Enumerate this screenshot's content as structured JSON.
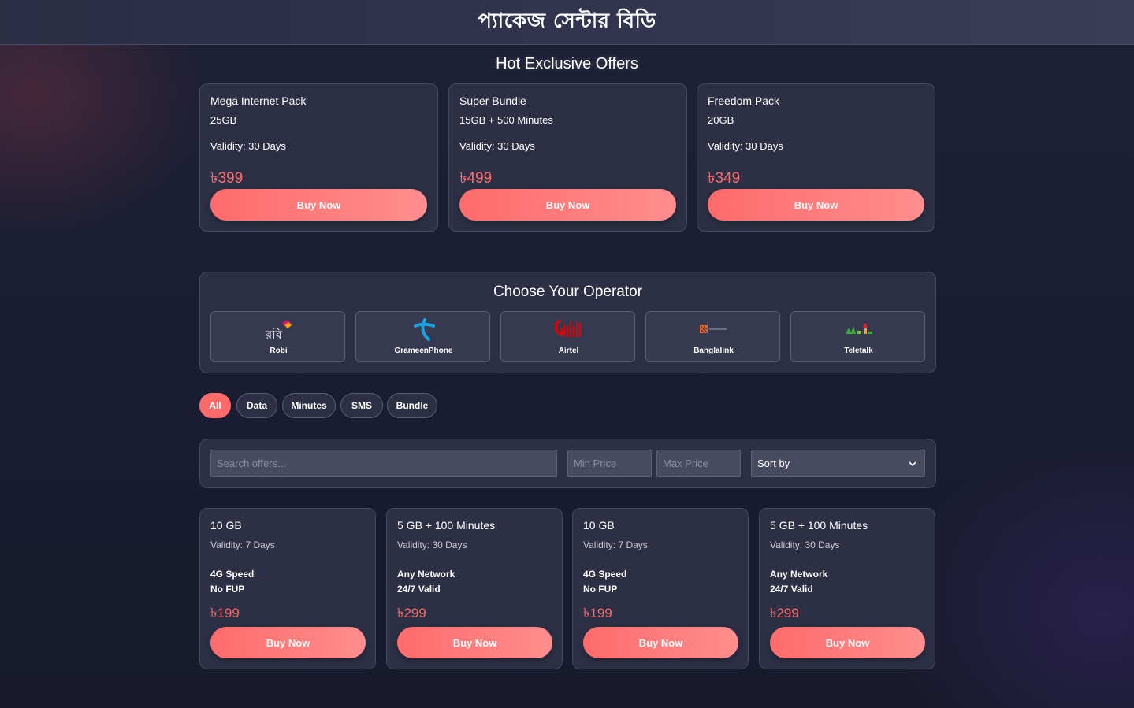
{
  "site_title": "প্যাকেজ সেন্টার বিডি",
  "hot_offers": {
    "title": "Hot Exclusive Offers",
    "items": [
      {
        "name": "Mega Internet Pack",
        "amount": "25GB",
        "validity": "Validity: 30 Days",
        "price": "৳399",
        "button": "Buy Now"
      },
      {
        "name": "Super Bundle",
        "amount": "15GB + 500 Minutes",
        "validity": "Validity: 30 Days",
        "price": "৳499",
        "button": "Buy Now"
      },
      {
        "name": "Freedom Pack",
        "amount": "20GB",
        "validity": "Validity: 30 Days",
        "price": "৳349",
        "button": "Buy Now"
      }
    ]
  },
  "operators": {
    "title": "Choose Your Operator",
    "items": [
      {
        "name": "Robi",
        "icon": "robi-logo"
      },
      {
        "name": "GrameenPhone",
        "icon": "grameenphone-logo"
      },
      {
        "name": "Airtel",
        "icon": "airtel-logo"
      },
      {
        "name": "Banglalink",
        "icon": "banglalink-logo"
      },
      {
        "name": "Teletalk",
        "icon": "teletalk-logo"
      }
    ]
  },
  "filters": [
    {
      "label": "All",
      "active": true
    },
    {
      "label": "Data",
      "active": false
    },
    {
      "label": "Minutes",
      "active": false
    },
    {
      "label": "SMS",
      "active": false
    },
    {
      "label": "Bundle",
      "active": false
    }
  ],
  "search": {
    "placeholder": "Search offers...",
    "min_price_placeholder": "Min Price",
    "max_price_placeholder": "Max Price",
    "sort_label": "Sort by"
  },
  "packages": [
    {
      "title": "10 GB",
      "validity": "Validity: 7 Days",
      "features": [
        "4G Speed",
        "No FUP"
      ],
      "price": "৳199",
      "button": "Buy Now"
    },
    {
      "title": "5 GB + 100 Minutes",
      "validity": "Validity: 30 Days",
      "features": [
        "Any Network",
        "24/7 Valid"
      ],
      "price": "৳299",
      "button": "Buy Now"
    },
    {
      "title": "10 GB",
      "validity": "Validity: 7 Days",
      "features": [
        "4G Speed",
        "No FUP"
      ],
      "price": "৳199",
      "button": "Buy Now"
    },
    {
      "title": "5 GB + 100 Minutes",
      "validity": "Validity: 30 Days",
      "features": [
        "Any Network",
        "24/7 Valid"
      ],
      "price": "৳299",
      "button": "Buy Now"
    }
  ],
  "colors": {
    "accent": "#ff6b6b",
    "card": "#2d3045",
    "background": "#1c1f35"
  }
}
